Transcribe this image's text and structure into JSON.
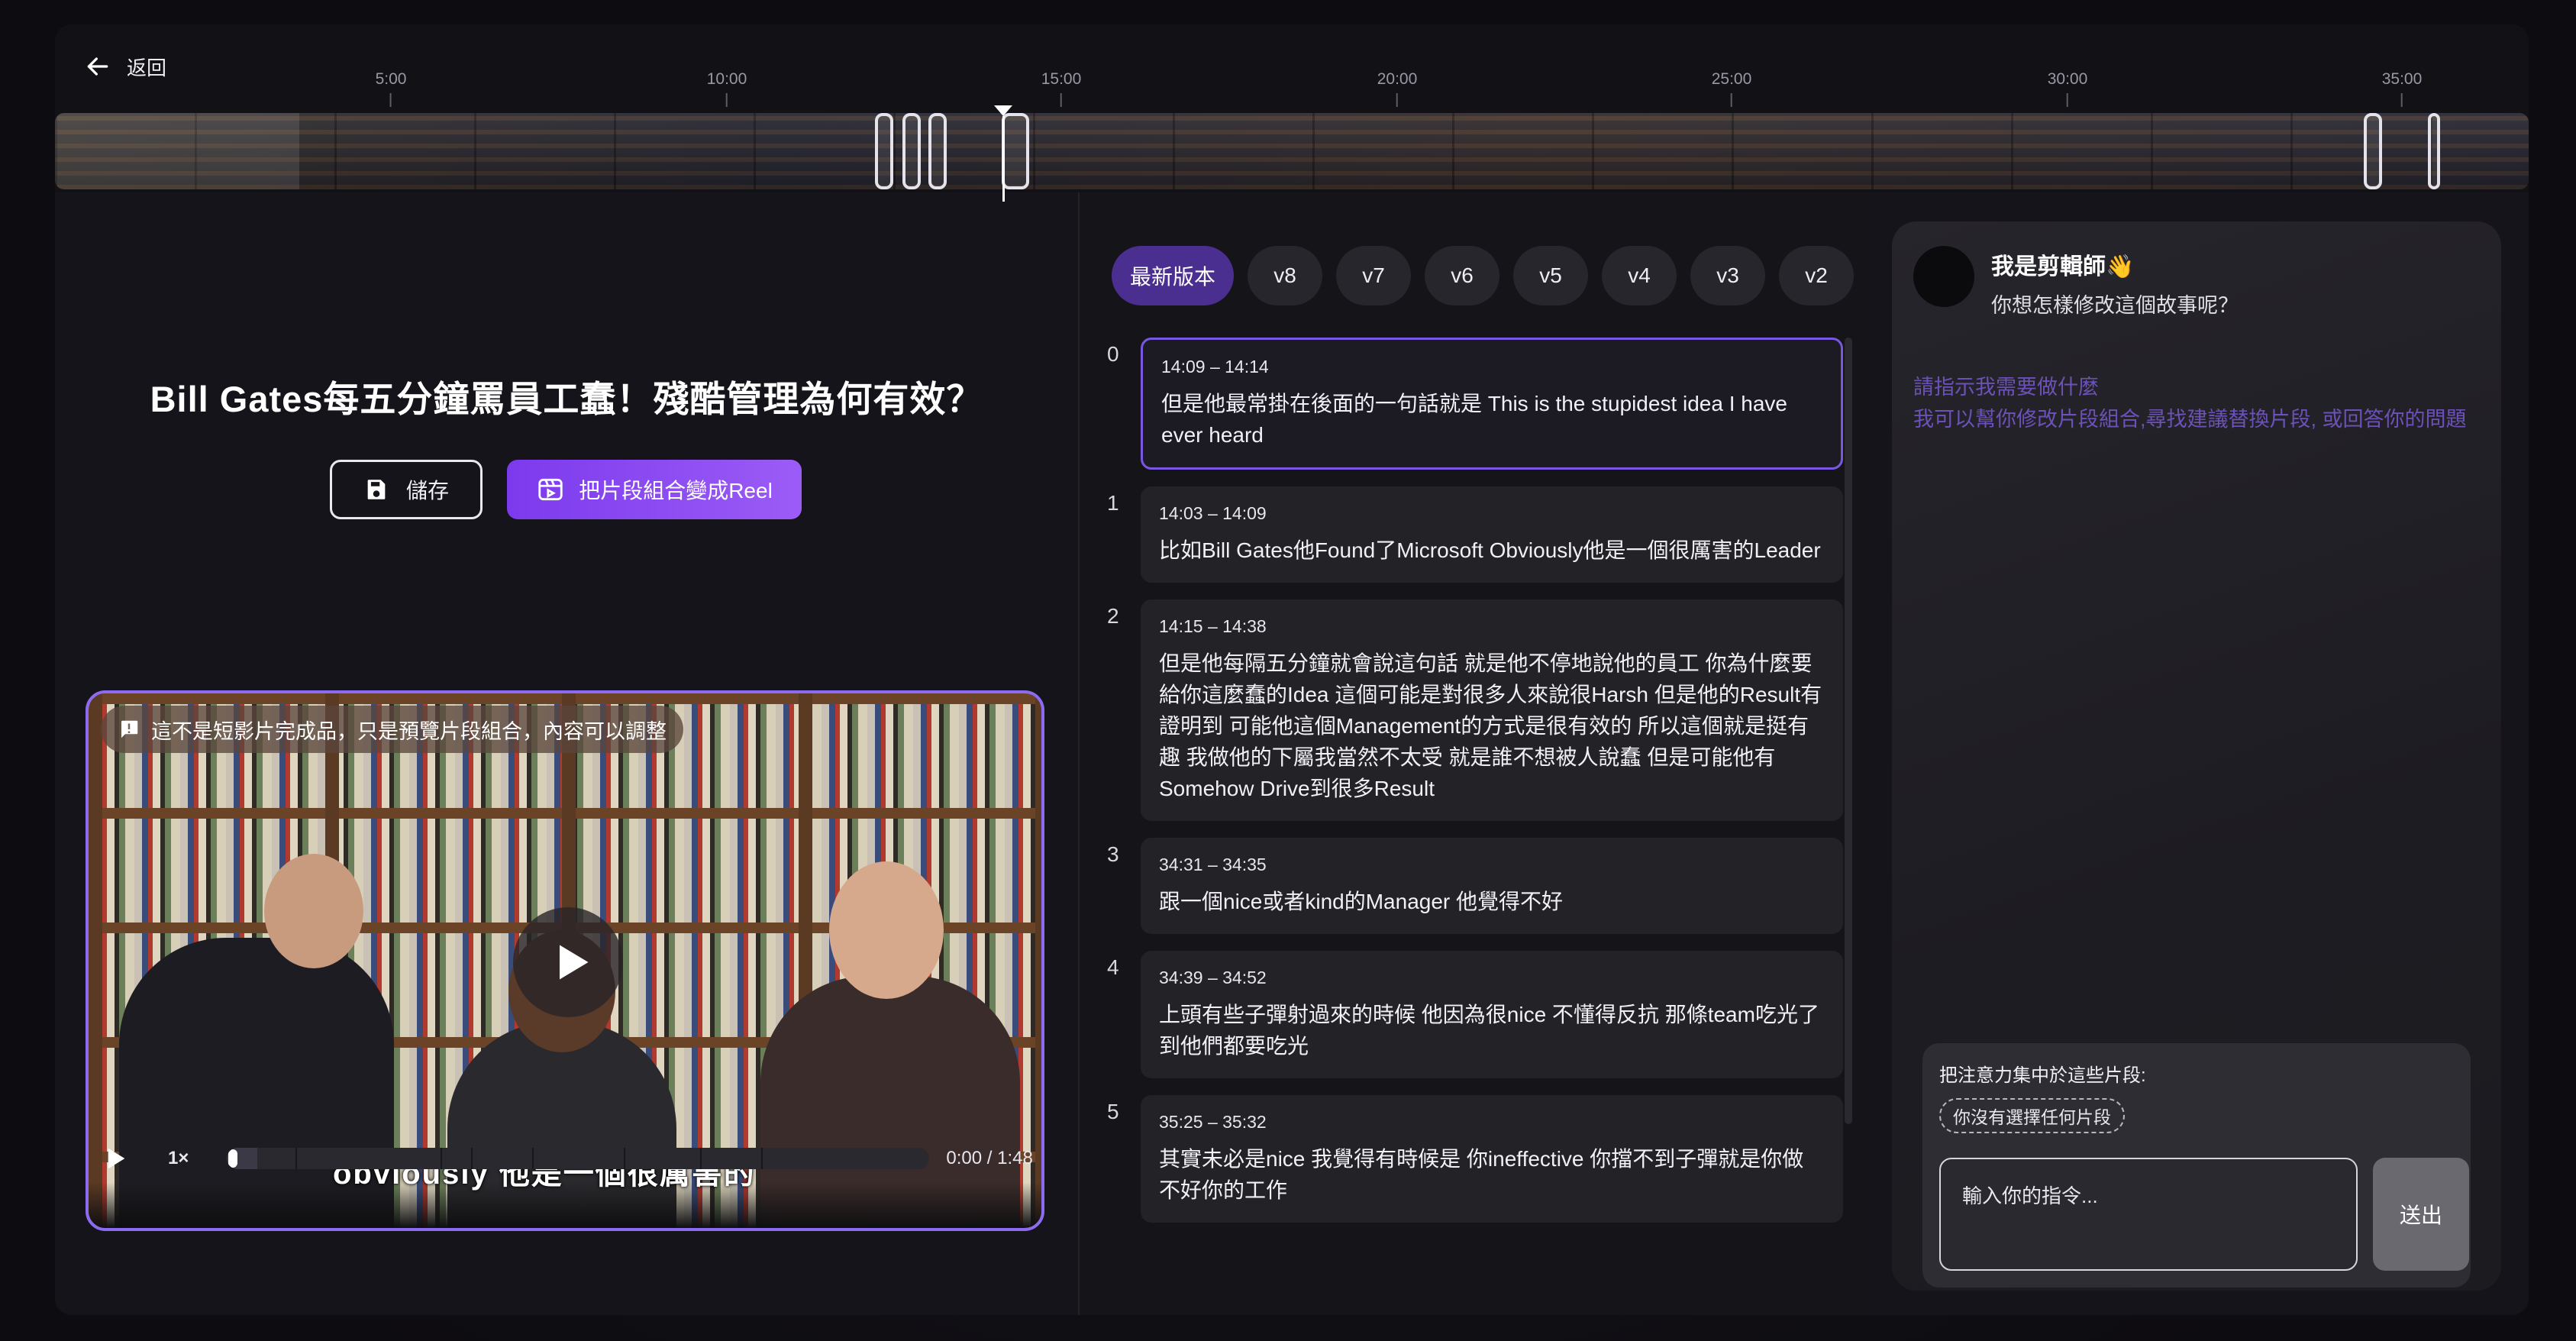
{
  "header": {
    "back_label": "返回",
    "ticks": [
      {
        "label": "5:00"
      },
      {
        "label": "10:00"
      },
      {
        "label": "15:00"
      },
      {
        "label": "20:00"
      },
      {
        "label": "25:00"
      },
      {
        "label": "30:00"
      },
      {
        "label": "35:00"
      }
    ]
  },
  "video_panel": {
    "title": "Bill Gates每五分鐘罵員工蠢！殘酷管理為何有效？",
    "save_label": "儲存",
    "reel_label": "把片段組合變成Reel",
    "notice": "這不是短影片完成品，只是預覽片段組合，內容可以調整",
    "burned_subtitle": "obviously 他是一個很厲害的",
    "speed": "1×",
    "timecode": "0:00 / 1:48",
    "progress_fraction": 0.0
  },
  "versions": {
    "tabs": [
      "最新版本",
      "v8",
      "v7",
      "v6",
      "v5",
      "v4",
      "v3",
      "v2"
    ],
    "active": "最新版本"
  },
  "clips": [
    {
      "index": "0",
      "time": "14:09 – 14:14",
      "text": "但是他最常掛在後面的一句話就是 This is the stupidest idea I have ever heard"
    },
    {
      "index": "1",
      "time": "14:03 – 14:09",
      "text": "比如Bill Gates他Found了Microsoft Obviously他是一個很厲害的Leader"
    },
    {
      "index": "2",
      "time": "14:15 – 14:38",
      "text": "但是他每隔五分鐘就會說這句話 就是他不停地說他的員工 你為什麼要給你這麼蠢的Idea 這個可能是對很多人來說很Harsh 但是他的Result有證明到 可能他這個Management的方式是很有效的 所以這個就是挺有趣 我做他的下屬我當然不太受 就是誰不想被人說蠢 但是可能他有Somehow Drive到很多Result"
    },
    {
      "index": "3",
      "time": "34:31 – 34:35",
      "text": "跟一個nice或者kind的Manager 他覺得不好"
    },
    {
      "index": "4",
      "time": "34:39 – 34:52",
      "text": "上頭有些子彈射過來的時候 他因為很nice 不懂得反抗 那條team吃光了 到他們都要吃光"
    },
    {
      "index": "5",
      "time": "35:25 – 35:32",
      "text": "其實未必是nice 我覺得有時候是 你ineffective 你擋不到子彈就是你做不好你的工作"
    }
  ],
  "assistant": {
    "name": "我是剪輯師👋",
    "greeting": "你想怎樣修改這個故事呢？",
    "hint": "請指示我需要做什麼\n我可以幫你修改片段組合,尋找建議替換片段, 或回答你的問題",
    "focus_label": "把注意力集中於這些片段:",
    "focus_chip": "你沒有選擇任何片段",
    "input_placeholder": "輸入你的指令...",
    "send_label": "送出"
  },
  "colors": {
    "accent": "#7c3aed",
    "active_tab": "#4a2f91",
    "hint_text": "#6c52b8"
  }
}
